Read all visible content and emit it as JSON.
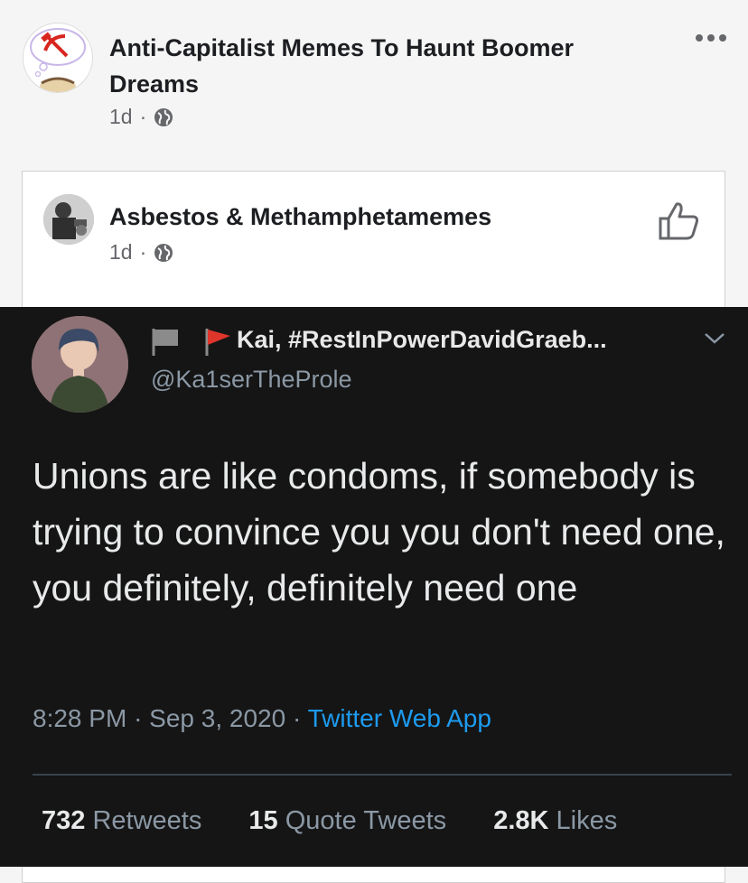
{
  "post": {
    "group_name": "Anti-Capitalist Memes To Haunt Boomer Dreams",
    "time": "1d",
    "separator": "·",
    "privacy_icon": "globe-icon",
    "menu_icon": "more-horizontal-icon"
  },
  "shared": {
    "page_name": "Asbestos & Methamphetamemes",
    "time": "1d",
    "separator": "·",
    "privacy_icon": "globe-icon",
    "action_icon": "thumbs-up-icon"
  },
  "tweet": {
    "display_name": "Kai, #RestInPowerDavidGraeb...",
    "handle": "@Ka1serTheProle",
    "text": "Unions are like condoms, if somebody is trying to convince you you don't need one, you definitely, definitely need one",
    "time": "8:28 PM",
    "date": "Sep 3, 2020",
    "meta_sep": "·",
    "source": "Twitter Web App",
    "retweets": "732",
    "retweets_label": "Retweets",
    "quotes": "15",
    "quotes_label": "Quote Tweets",
    "likes": "2.8K",
    "likes_label": "Likes",
    "flag_colors": [
      "#8b8b8b",
      "#e0352b"
    ],
    "link_color": "#1d9bf0"
  }
}
